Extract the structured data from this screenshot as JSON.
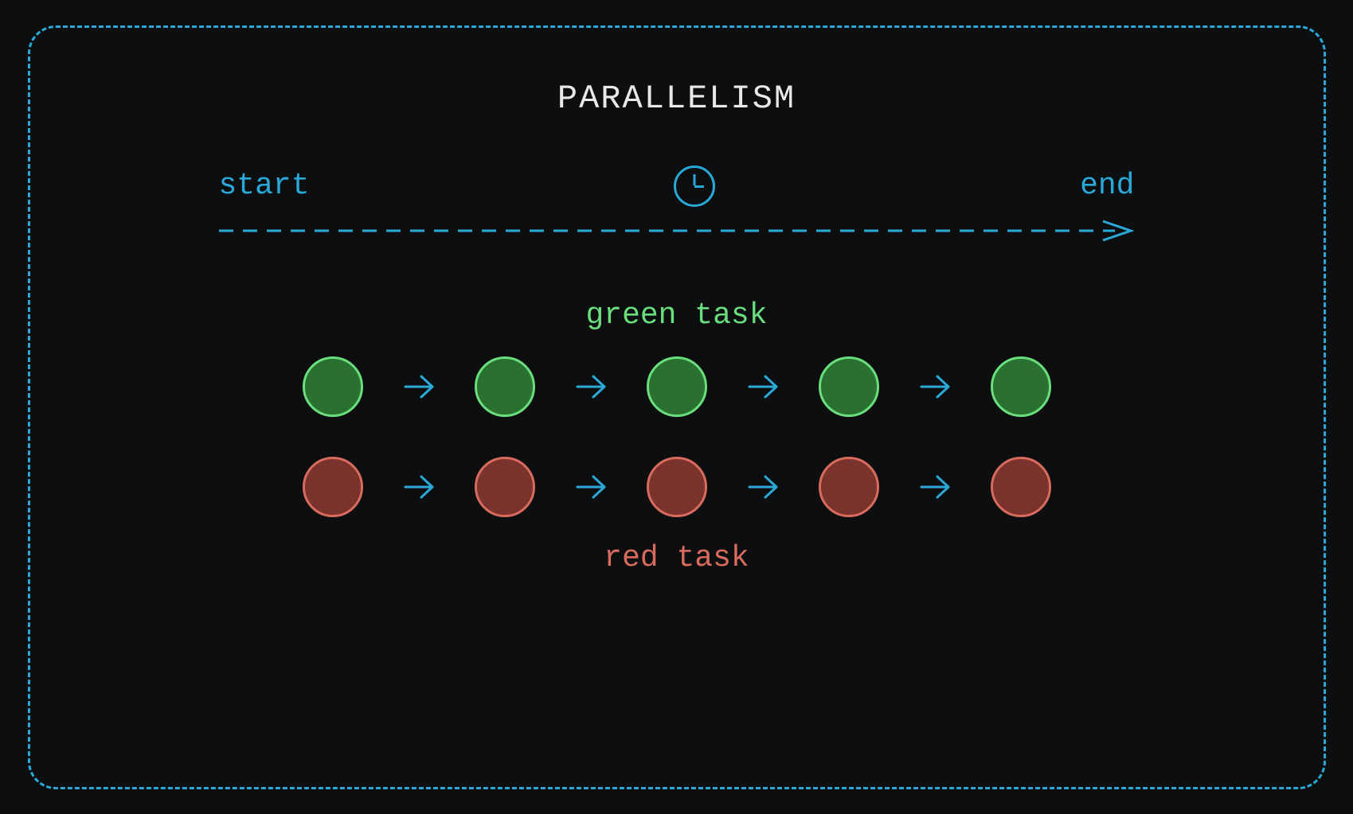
{
  "title": "PARALLELISM",
  "timeline": {
    "start_label": "start",
    "end_label": "end",
    "icon": "clock-icon"
  },
  "tasks": {
    "green": {
      "label": "green task",
      "color_fill": "#2a7030",
      "color_stroke": "#6ade7c",
      "step_count": 5
    },
    "red": {
      "label": "red task",
      "color_fill": "#7a332c",
      "color_stroke": "#d86b5e",
      "step_count": 5
    }
  },
  "accent_color": "#2aa9d8"
}
